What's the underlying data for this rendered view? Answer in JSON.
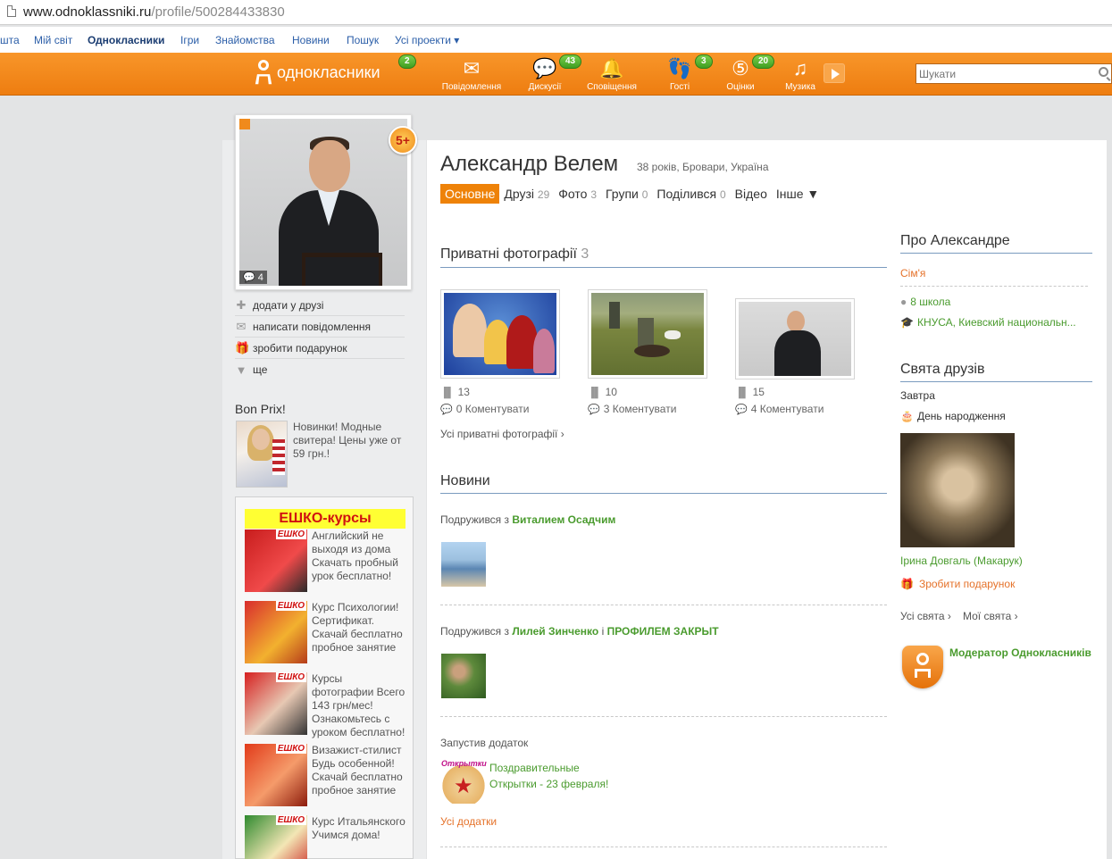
{
  "browser": {
    "url_host": "www.odnoklassniki.ru",
    "url_path": "/profile/500284433830"
  },
  "toplinks": [
    "шта",
    "Мій світ",
    "Однокласники",
    "Ігри",
    "Знайомства",
    "Новини",
    "Пошук",
    "Усі проекти ▾"
  ],
  "topbar": {
    "logo_text": "однокласники",
    "logo_badge": "2",
    "nav": [
      {
        "label": "Повідомлення",
        "icon": "envelope-icon",
        "badge": ""
      },
      {
        "label": "Дискусії",
        "icon": "discussions-icon",
        "badge": "43"
      },
      {
        "label": "Сповіщення",
        "icon": "bell-icon",
        "badge": ""
      },
      {
        "label": "Гості",
        "icon": "footprints-icon",
        "badge": "3"
      },
      {
        "label": "Оцінки",
        "icon": "rating-icon",
        "badge": "20"
      },
      {
        "label": "Музика",
        "icon": "music-note-icon",
        "badge": ""
      }
    ],
    "search_placeholder": "Шукати"
  },
  "avatar": {
    "comments_count": "4",
    "badge": "5+"
  },
  "actions": [
    {
      "label": "додати у друзі",
      "icon": "plus-icon"
    },
    {
      "label": "написати повідомлення",
      "icon": "envelope-icon"
    },
    {
      "label": "зробити подарунок",
      "icon": "gift-icon"
    },
    {
      "label": "ще",
      "icon": "triangle-down-icon"
    }
  ],
  "ad_bonprix": {
    "title": "Bon Prix!",
    "text": "Новинки! Модные свитера! Цены уже от 59 грн.!"
  },
  "ad_eshko": {
    "title": "ЕШКО-курсы",
    "brand_tag": "ЕШКО",
    "items": [
      "Английский не выходя из дома Скачать пробный урок бесплатно!",
      "Курс Психологии! Сертификат. Скачай бесплатно пробное занятие",
      "Курсы фотографии Всего 143 грн/мес! Ознакомьтесь с уроком бесплатно!",
      "Визажист-стилист Будь особенной! Скачай бесплатно пробное занятие",
      "Курс Итальянского Учимся дома!"
    ]
  },
  "profile": {
    "name": "Александр Велем",
    "meta": "38 років, Бровари, Україна",
    "tabs": [
      {
        "label": "Основне",
        "count": ""
      },
      {
        "label": "Друзі",
        "count": "29"
      },
      {
        "label": "Фото",
        "count": "3"
      },
      {
        "label": "Групи",
        "count": "0"
      },
      {
        "label": "Поділився",
        "count": "0"
      },
      {
        "label": "Відео",
        "count": ""
      },
      {
        "label": "Інше ▼",
        "count": ""
      }
    ]
  },
  "photos": {
    "title": "Приватні фотографії",
    "count": "3",
    "items": [
      {
        "views": "13",
        "comments": "0 Коментувати"
      },
      {
        "views": "10",
        "comments": "3 Коментувати"
      },
      {
        "views": "15",
        "comments": "4 Коментувати"
      }
    ],
    "all_link": "Усі приватні фотографії ›"
  },
  "news": {
    "title": "Новини",
    "item1": {
      "prefix": "Подружився з",
      "name": "Виталием Осадчим"
    },
    "item2": {
      "prefix": "Подружився з",
      "name1": "Лилей Зинченко",
      "joiner": "і",
      "name2": "ПРОФИЛЕМ ЗАКРЫТ"
    },
    "item3": {
      "text": "Запустив додаток",
      "app_line1": "Поздравительные",
      "app_line2": "Открытки - 23 февраля!",
      "app_tag": "Открытки"
    },
    "all_apps": "Усі додатки"
  },
  "about": {
    "title": "Про Александре",
    "family": "Сім'я",
    "school": "8 школа",
    "university": "КНУСА, Киевский национальн..."
  },
  "holidays": {
    "title": "Свята друзів",
    "when": "Завтра",
    "event": "День народження",
    "person": "Ірина Довгаль (Макарук)",
    "gift": "Зробити подарунок",
    "all": "Усі свята ›",
    "mine": "Мої свята ›"
  },
  "moderator": {
    "label": "Модератор Однокласників"
  },
  "colors": {
    "orange": "#ee8208",
    "green_badge": "#4fae2c",
    "link_green": "#4a9b2e",
    "link_orange": "#e5722a",
    "link_blue": "#2b5ea8"
  }
}
